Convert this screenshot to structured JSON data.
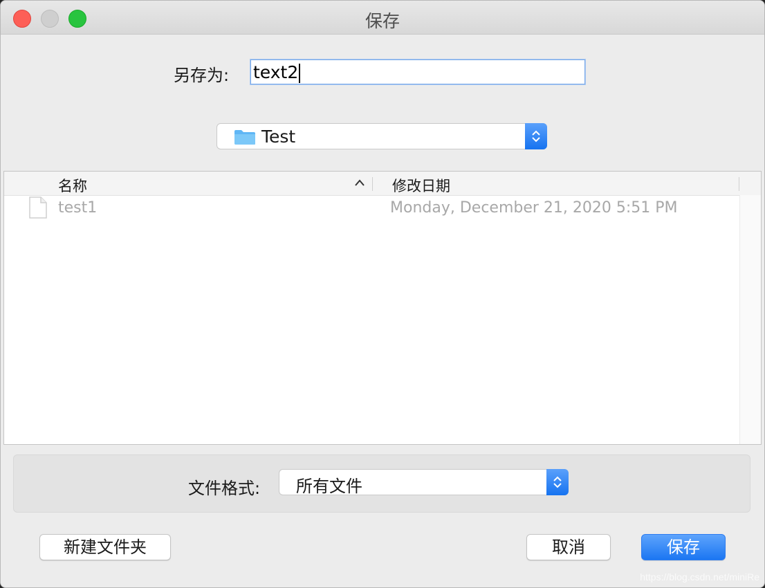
{
  "window": {
    "title": "保存"
  },
  "save_as": {
    "label": "另存为:",
    "value": "text2"
  },
  "location": {
    "folder": "Test"
  },
  "columns": {
    "name": "名称",
    "date": "修改日期"
  },
  "files": [
    {
      "name": "test1",
      "modified": "Monday, December 21, 2020 5:51 PM"
    }
  ],
  "format": {
    "label": "文件格式:",
    "value": "所有文件"
  },
  "buttons": {
    "new_folder": "新建文件夹",
    "cancel": "取消",
    "save": "保存"
  },
  "watermark": "https://blog.csdn.net/miniRe",
  "colors": {
    "accent": "#1b76f2",
    "close": "#fd5f57",
    "maximize": "#29c43f"
  }
}
